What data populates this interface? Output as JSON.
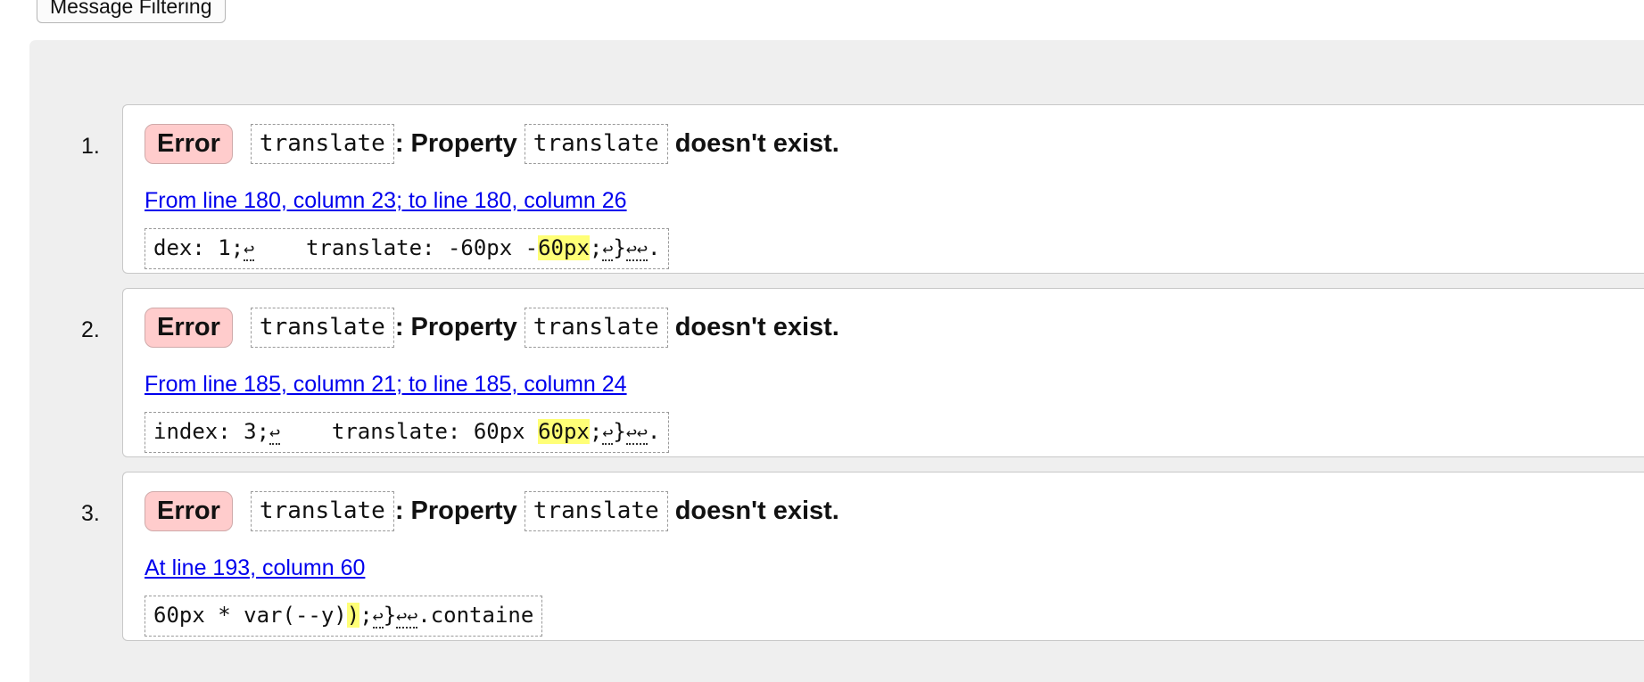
{
  "toolbar": {
    "filter_label": "Message Filtering"
  },
  "messages": [
    {
      "num": "1.",
      "badge": "Error",
      "code1": "translate",
      "text1": ": Property",
      "code2": "translate",
      "text2": "doesn't exist.",
      "location": "From line 180, column 23; to line 180, column 26",
      "extract": {
        "before": "dex: 1;",
        "ws1": "↩",
        "mid": "    translate: -60px -",
        "highlight": "60px",
        "after_hl": ";",
        "ws2": "↩",
        "brace": "}",
        "ws3": "↩↩",
        "end": "."
      }
    },
    {
      "num": "2.",
      "badge": "Error",
      "code1": "translate",
      "text1": ": Property",
      "code2": "translate",
      "text2": "doesn't exist.",
      "location": "From line 185, column 21; to line 185, column 24",
      "extract": {
        "before": "index: 3;",
        "ws1": "↩",
        "mid": "    translate: 60px ",
        "highlight": "60px",
        "after_hl": ";",
        "ws2": "↩",
        "brace": "}",
        "ws3": "↩↩",
        "end": "."
      }
    },
    {
      "num": "3.",
      "badge": "Error",
      "code1": "translate",
      "text1": ": Property",
      "code2": "translate",
      "text2": "doesn't exist.",
      "location": "At line 193, column 60",
      "extract": {
        "before": "60px * var(--y)",
        "highlight": ")",
        "after_hl": ";",
        "ws2": "↩",
        "brace": "}",
        "ws3": "↩↩",
        "end": ".containe"
      }
    }
  ]
}
